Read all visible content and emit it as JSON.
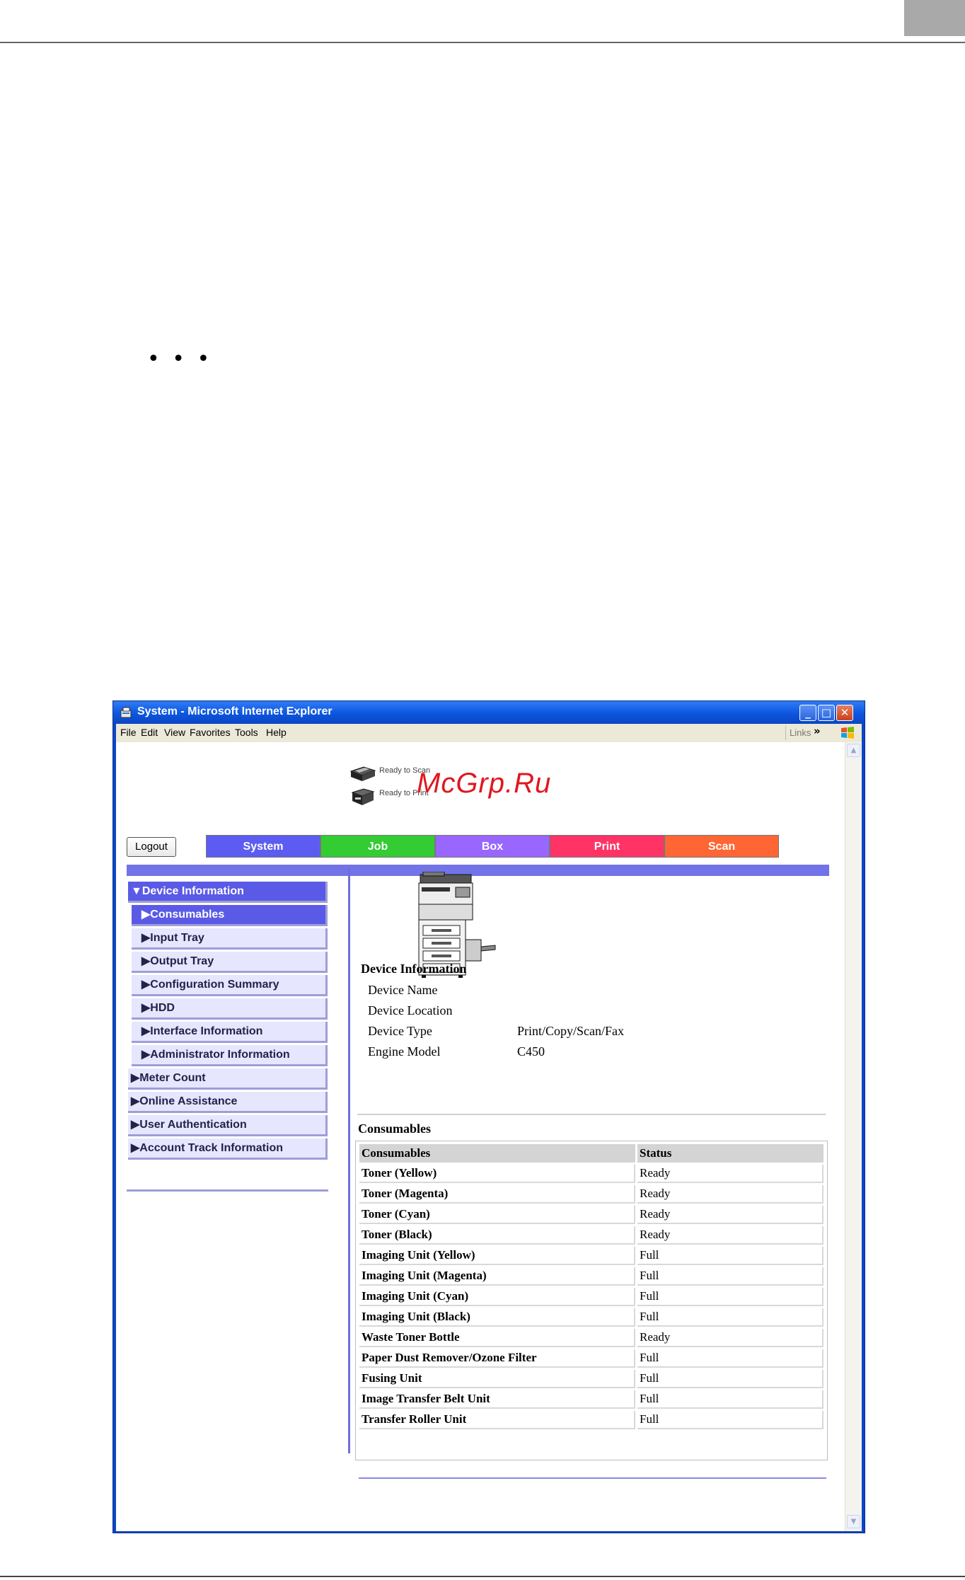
{
  "page": {
    "dots": "• • •"
  },
  "window": {
    "title": "System - Microsoft Internet Explorer",
    "buttons": {
      "minimize": "_",
      "maximize": "□",
      "close": "✕"
    },
    "menu": [
      "File",
      "Edit",
      "View",
      "Favorites",
      "Tools",
      "Help"
    ],
    "links_label": "Links",
    "links_chevron": "»"
  },
  "status": {
    "scan": "Ready to Scan",
    "print": "Ready to Print"
  },
  "watermark": "McGrp.Ru",
  "logout_label": "Logout",
  "tabs": [
    {
      "label": "System",
      "color": "#5c5cf2"
    },
    {
      "label": "Job",
      "color": "#33cc33"
    },
    {
      "label": "Box",
      "color": "#9966ff"
    },
    {
      "label": "Print",
      "color": "#ff3366"
    },
    {
      "label": "Scan",
      "color": "#ff6633"
    }
  ],
  "nav": {
    "items": [
      {
        "label": "▼Device Information"
      },
      {
        "label": "▶Consumables"
      },
      {
        "label": "▶Input Tray"
      },
      {
        "label": "▶Output Tray"
      },
      {
        "label": "▶Configuration Summary"
      },
      {
        "label": "▶HDD"
      },
      {
        "label": "▶Interface Information"
      },
      {
        "label": "▶Administrator Information"
      },
      {
        "label": "▶Meter Count"
      },
      {
        "label": "▶Online Assistance"
      },
      {
        "label": "▶User Authentication"
      },
      {
        "label": "▶Account Track Information"
      }
    ]
  },
  "device_info": {
    "title": "Device Information",
    "rows": [
      {
        "label": "Device Name",
        "value": ""
      },
      {
        "label": "Device Location",
        "value": ""
      },
      {
        "label": "Device Type",
        "value": "Print/Copy/Scan/Fax"
      },
      {
        "label": "Engine Model",
        "value": "C450"
      }
    ]
  },
  "consumables": {
    "caption": "Consumables",
    "headers": [
      "Consumables",
      "Status"
    ],
    "rows": [
      [
        "Toner (Yellow)",
        "Ready"
      ],
      [
        "Toner (Magenta)",
        "Ready"
      ],
      [
        "Toner (Cyan)",
        "Ready"
      ],
      [
        "Toner (Black)",
        "Ready"
      ],
      [
        "Imaging Unit (Yellow)",
        "Full"
      ],
      [
        "Imaging Unit (Magenta)",
        "Full"
      ],
      [
        "Imaging Unit (Cyan)",
        "Full"
      ],
      [
        "Imaging Unit (Black)",
        "Full"
      ],
      [
        "Waste Toner Bottle",
        "Ready"
      ],
      [
        "Paper Dust Remover/Ozone Filter",
        "Full"
      ],
      [
        "Fusing Unit",
        "Full"
      ],
      [
        "Image Transfer Belt Unit",
        "Full"
      ],
      [
        "Transfer Roller Unit",
        "Full"
      ]
    ]
  }
}
